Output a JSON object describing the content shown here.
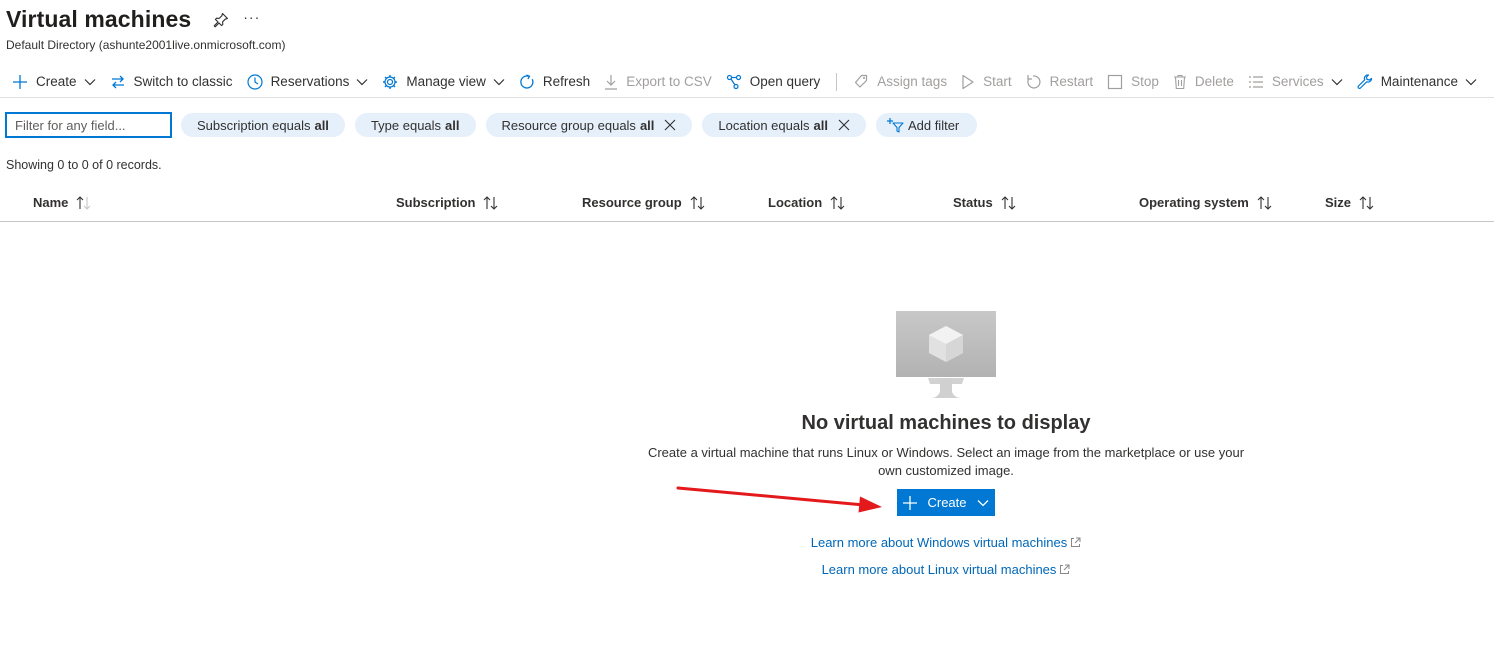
{
  "header": {
    "title": "Virtual machines",
    "more": "···",
    "subtitle": "Default Directory (ashunte2001live.onmicrosoft.com)"
  },
  "toolbar": {
    "create": "Create",
    "switch_classic": "Switch to classic",
    "reservations": "Reservations",
    "manage_view": "Manage view",
    "refresh": "Refresh",
    "export_csv": "Export to CSV",
    "open_query": "Open query",
    "assign_tags": "Assign tags",
    "start": "Start",
    "restart": "Restart",
    "stop": "Stop",
    "delete": "Delete",
    "services": "Services",
    "maintenance": "Maintenance"
  },
  "filters": {
    "placeholder": "Filter for any field...",
    "pills": [
      {
        "label": "Subscription equals",
        "value": "all"
      },
      {
        "label": "Type equals",
        "value": "all"
      },
      {
        "label": "Resource group equals",
        "value": "all"
      },
      {
        "label": "Location equals",
        "value": "all"
      }
    ],
    "add_filter": "Add filter"
  },
  "records": "Showing 0 to 0 of 0 records.",
  "columns": [
    "Name",
    "Subscription",
    "Resource group",
    "Location",
    "Status",
    "Operating system",
    "Size"
  ],
  "empty_state": {
    "title": "No virtual machines to display",
    "description": "Create a virtual machine that runs Linux or Windows. Select an image from the marketplace or use your own customized image.",
    "create_button": "Create",
    "learn_windows": "Learn more about Windows virtual machines",
    "learn_linux": "Learn more about Linux virtual machines"
  },
  "colors": {
    "accent": "#0078d4",
    "link": "#0067b8",
    "pill_bg": "#e5f0fb",
    "disabled": "#a19f9d",
    "annotation_arrow": "#e3191c"
  }
}
